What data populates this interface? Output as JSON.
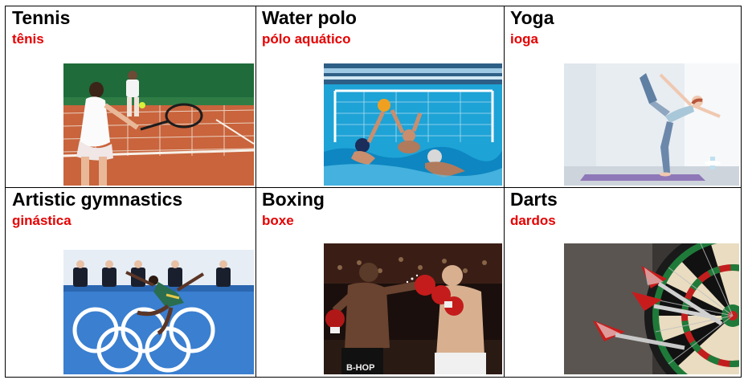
{
  "sports": [
    {
      "id": "tennis",
      "title": "Tennis",
      "translation": "tênis"
    },
    {
      "id": "water-polo",
      "title": "Water polo",
      "translation": "pólo aquático"
    },
    {
      "id": "yoga",
      "title": "Yoga",
      "translation": "ioga"
    },
    {
      "id": "artistic-gymnastics",
      "title": "Artistic gymnastics",
      "translation": "ginástica"
    },
    {
      "id": "boxing",
      "title": "Boxing",
      "translation": "boxe"
    },
    {
      "id": "darts",
      "title": "Darts",
      "translation": "dardos"
    }
  ],
  "photo_text": {
    "boxing_trunks": "B-HOP"
  },
  "colors": {
    "title": "#000000",
    "translation": "#e60000",
    "border": "#000000"
  }
}
